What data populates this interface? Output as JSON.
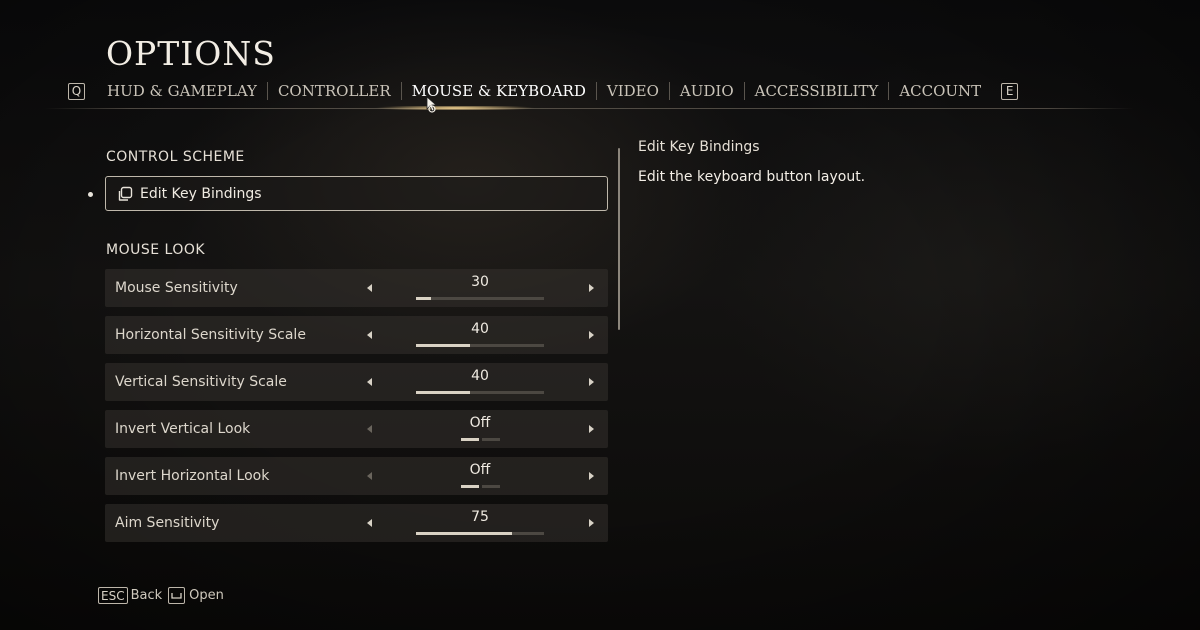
{
  "header": {
    "title": "OPTIONS"
  },
  "tabs": {
    "prev_key": "Q",
    "next_key": "E",
    "items": [
      {
        "label": "HUD & GAMEPLAY"
      },
      {
        "label": "CONTROLLER"
      },
      {
        "label": "MOUSE & KEYBOARD",
        "active": true
      },
      {
        "label": "VIDEO"
      },
      {
        "label": "AUDIO"
      },
      {
        "label": "ACCESSIBILITY"
      },
      {
        "label": "ACCOUNT"
      }
    ]
  },
  "control_scheme": {
    "heading": "CONTROL SCHEME",
    "edit_key_bindings": {
      "label": "Edit Key Bindings",
      "icon": "copy-icon"
    }
  },
  "mouse_look": {
    "heading": "MOUSE LOOK",
    "settings": [
      {
        "label": "Mouse Sensitivity",
        "type": "slider",
        "value": "30",
        "level": 0.12
      },
      {
        "label": "Horizontal Sensitivity Scale",
        "type": "slider",
        "value": "40",
        "level": 0.42
      },
      {
        "label": "Vertical Sensitivity Scale",
        "type": "slider",
        "value": "40",
        "level": 0.42
      },
      {
        "label": "Invert Vertical Look",
        "type": "toggle",
        "value": "Off",
        "state_index": 0,
        "states": 2
      },
      {
        "label": "Invert Horizontal Look",
        "type": "toggle",
        "value": "Off",
        "state_index": 0,
        "states": 2
      },
      {
        "label": "Aim Sensitivity",
        "type": "slider",
        "value": "75",
        "level": 0.75
      }
    ]
  },
  "description": {
    "title": "Edit Key Bindings",
    "text": "Edit the keyboard button layout."
  },
  "footer": {
    "back_key": "ESC",
    "back_label": "Back",
    "open_icon": "space-bar-icon",
    "open_label": "Open"
  },
  "colors": {
    "text": "#e8e3da",
    "row_bg": "#34312d",
    "slider_fill": "#d9d2c4",
    "slider_track": "#4c4842",
    "accent_glow": "#ffdc96"
  }
}
